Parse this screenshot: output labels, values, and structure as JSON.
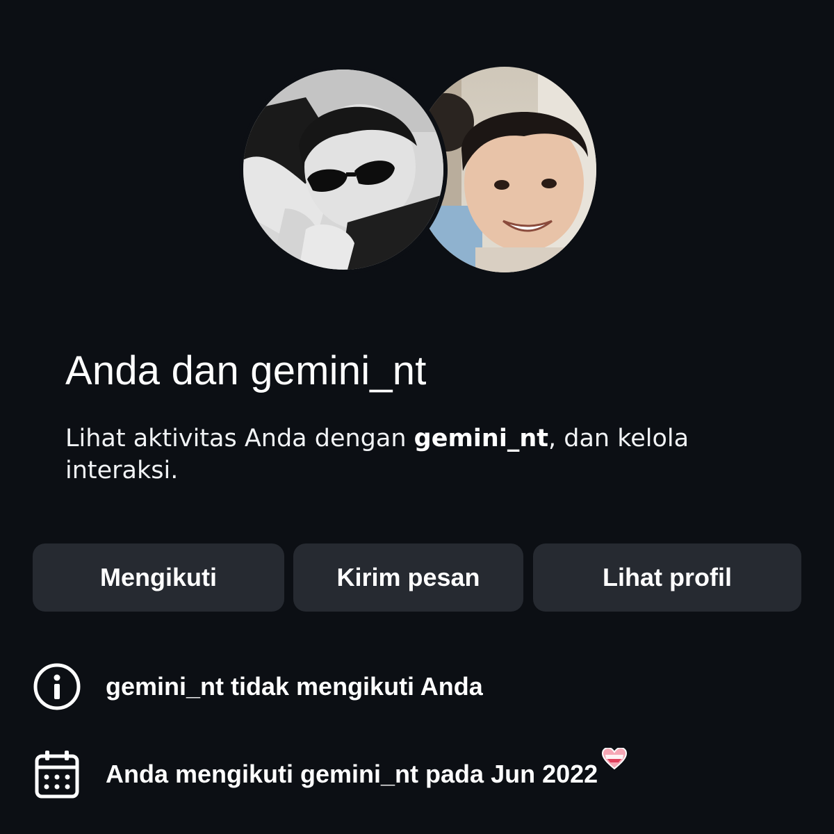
{
  "header": {
    "title": "Anda dan gemini_nt",
    "subtitle_prefix": "Lihat aktivitas Anda dengan ",
    "subtitle_username": "gemini_nt",
    "subtitle_suffix": ", dan kelola interaksi."
  },
  "avatars": {
    "left_icon": "profile-photo-grayscale",
    "right_icon": "profile-photo-color"
  },
  "actions": {
    "follow_label": "Mengikuti",
    "message_label": "Kirim pesan",
    "profile_label": "Lihat profil"
  },
  "info": {
    "not_following_text": "gemini_nt tidak mengikuti Anda",
    "followed_since_text": "Anda mengikuti gemini_nt pada Jun 2022",
    "info_icon": "info-icon",
    "calendar_icon": "calendar-icon",
    "heart_icon": "heart-emoji-icon"
  },
  "colors": {
    "background": "#0c0f14",
    "button_background": "#262a31",
    "text": "#ffffff"
  }
}
